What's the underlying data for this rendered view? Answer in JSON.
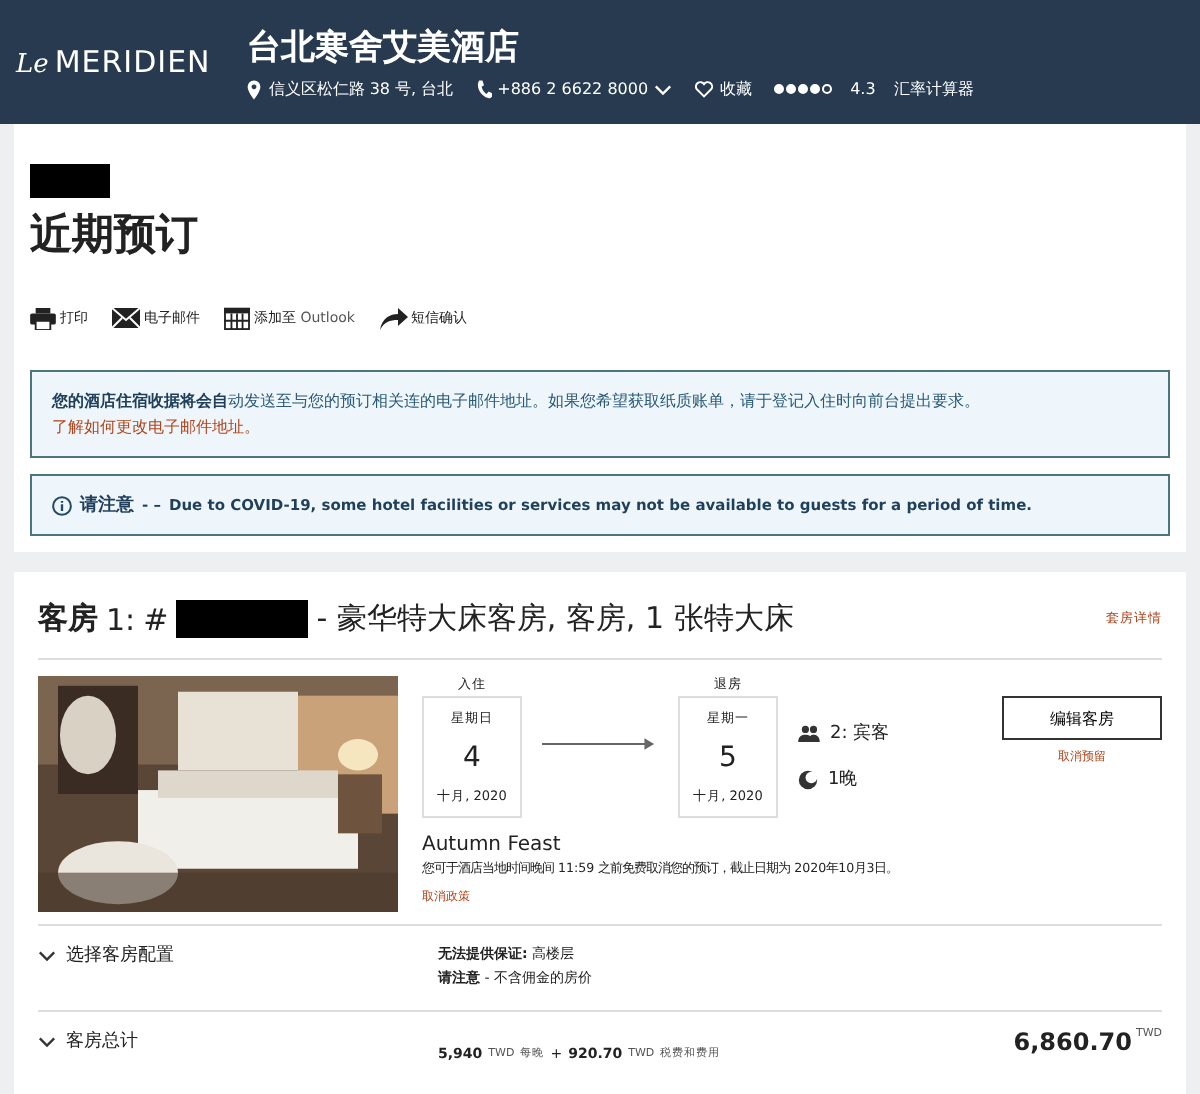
{
  "header": {
    "logo_script": "Le",
    "logo_text": "MERIDIEN",
    "hotel_name": "台北寒舍艾美酒店",
    "address": "信义区松仁路 38 号, 台北",
    "phone": "+886 2 6622 8000",
    "favorite": "收藏",
    "stars": 4,
    "rating": "4.3",
    "currency_link": "汇率计算器"
  },
  "page": {
    "title": "近期预订",
    "actions": [
      {
        "kind": "print",
        "label": "打印"
      },
      {
        "kind": "email",
        "label": "电子邮件"
      },
      {
        "kind": "calendar",
        "label": "添加至",
        "suffix": "Outlook"
      },
      {
        "kind": "share",
        "label": "短信确认"
      }
    ],
    "info": {
      "bold": "您的酒店住宿收据将会自",
      "text": "动发送至与您的预订相关连的电子邮件地址。如果您希望获取纸质账单，请于登记入住时向前台提出要求。",
      "link": "了解如何更改电子邮件地址。"
    },
    "notice": {
      "label": "请注意",
      "dash": "- –",
      "text": "Due to COVID-19, some hotel facilities or services may not be available to guests for a period of time."
    }
  },
  "room": {
    "prefix": "客房",
    "number": "1:",
    "hash": "#",
    "title": "- 豪华特大床客房, 客房, 1 张特大床",
    "details_link": "套房详情",
    "check_in": {
      "label": "入住",
      "weekday": "星期日",
      "day": "4",
      "month": "十月, 2020"
    },
    "check_out": {
      "label": "退房",
      "weekday": "星期一",
      "day": "5",
      "month": "十月, 2020"
    },
    "guests": "2: 宾客",
    "nights": "1晚",
    "edit_button": "编辑客房",
    "cancel_link": "取消预留",
    "rate_name": "Autumn Feast",
    "policy": "您可于酒店当地时间晚间 11:59 之前免费取消您的预订，截止日期为 2020年10月3日。",
    "policy_link": "取消政策",
    "options_toggle": "选择客房配置",
    "no_guarantee_label": "无法提供保证:",
    "no_guarantee_value": "高楼层",
    "note_label": "请注意",
    "note_value": "- 不含佣金的房价",
    "total_toggle": "客房总计",
    "nightly": "5,940",
    "nightly_cur": "TWD",
    "nightly_label": "每晚",
    "plus": "+",
    "taxes": "920.70",
    "taxes_cur": "TWD",
    "taxes_label": "税费和费用",
    "total": "6,860.70",
    "total_cur": "TWD"
  }
}
